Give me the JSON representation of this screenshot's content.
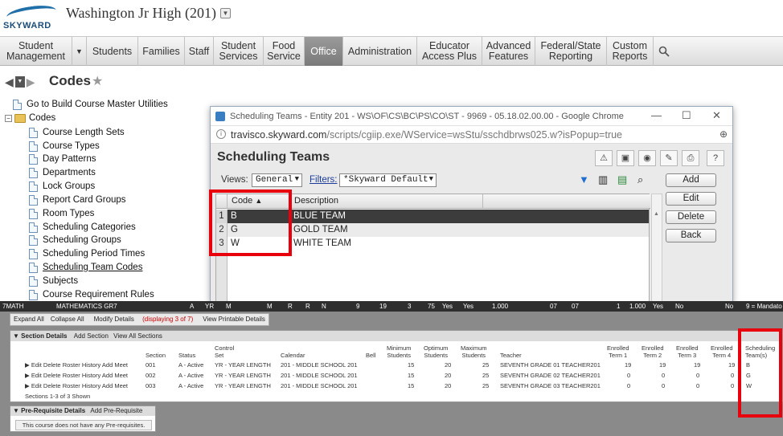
{
  "header": {
    "logo_text": "SKYWARD",
    "school": "Washington Jr High (201)"
  },
  "nav": [
    {
      "label": "Student\nManagement"
    },
    {
      "label": "Students"
    },
    {
      "label": "Families"
    },
    {
      "label": "Staff"
    },
    {
      "label": "Student\nServices"
    },
    {
      "label": "Food\nService"
    },
    {
      "label": "Office",
      "active": true
    },
    {
      "label": "Administration"
    },
    {
      "label": "Educator\nAccess Plus"
    },
    {
      "label": "Advanced\nFeatures"
    },
    {
      "label": "Federal/State\nReporting"
    },
    {
      "label": "Custom\nReports"
    }
  ],
  "page_title": "Codes",
  "tree": {
    "top": "Go to Build Course Master Utilities",
    "folder": "Codes",
    "items": [
      "Course Length Sets",
      "Course Types",
      "Day Patterns",
      "Departments",
      "Lock Groups",
      "Report Card Groups",
      "Room Types",
      "Scheduling Categories",
      "Scheduling Groups",
      "Scheduling Period Times",
      "Scheduling Team Codes",
      "Subjects",
      "Course Requirement Rules"
    ]
  },
  "popup": {
    "window_title": "Scheduling Teams - Entity 201 - WS\\OF\\CS\\BC\\PS\\CO\\ST - 9969 - 05.18.02.00.00 - Google Chrome",
    "url_host": "travisco.skyward.com",
    "url_path": "/scripts/cgiip.exe/WService=wsStu/sschdbrws025.w?isPopup=true",
    "title": "Scheduling Teams",
    "views_label": "Views:",
    "views_value": "General",
    "filters_label": "Filters:",
    "filters_value": "*Skyward Default",
    "columns": [
      "Code",
      "Description"
    ],
    "rows": [
      {
        "num": "1",
        "code": "B",
        "desc": "BLUE TEAM"
      },
      {
        "num": "2",
        "code": "G",
        "desc": "GOLD TEAM"
      },
      {
        "num": "3",
        "code": "W",
        "desc": "WHITE TEAM"
      }
    ],
    "buttons": [
      "Add",
      "Edit",
      "Delete",
      "Back"
    ]
  },
  "darkbar": [
    "7MATH",
    "MATHEMATICS GR7",
    "A",
    "YR",
    "M",
    "M",
    "R",
    "R",
    "N",
    "9",
    "19",
    "3",
    "75",
    "Yes",
    "Yes",
    "1.000",
    "07",
    "07",
    "1",
    "1.000",
    "Yes",
    "No",
    "No",
    "9 = Mandato"
  ],
  "lower": {
    "toolbar": [
      "Expand All",
      "Collapse All",
      "Modify Details"
    ],
    "displaying": "(displaying 3 of 7)",
    "printable": "View Printable Details",
    "section_header": "Section Details",
    "add_section": "Add Section",
    "view_all": "View All Sections",
    "columns": [
      "Section",
      "Status",
      "Control\nSet",
      "Calendar",
      "Bell",
      "Minimum\nStudents",
      "Optimum\nStudents",
      "Maximum\nStudents",
      "Teacher",
      "Enrolled\nTerm 1",
      "Enrolled\nTerm 2",
      "Enrolled\nTerm 3",
      "Enrolled\nTerm 4",
      "Scheduling\nTeam(s)"
    ],
    "row_actions": [
      "Edit",
      "Delete",
      "Roster",
      "History",
      "Add Meet"
    ],
    "rows": [
      {
        "section": "001",
        "status": "A - Active",
        "control": "YR - YEAR LENGTH",
        "calendar": "201 - MIDDLE SCHOOL 201",
        "min": "15",
        "opt": "20",
        "max": "25",
        "teacher": "SEVENTH GRADE 01 TEACHER201",
        "t1": "19",
        "t2": "19",
        "t3": "19",
        "t4": "19",
        "team": "B"
      },
      {
        "section": "002",
        "status": "A - Active",
        "control": "YR - YEAR LENGTH",
        "calendar": "201 - MIDDLE SCHOOL 201",
        "min": "15",
        "opt": "20",
        "max": "25",
        "teacher": "SEVENTH GRADE 02 TEACHER201",
        "t1": "0",
        "t2": "0",
        "t3": "0",
        "t4": "0",
        "team": "G"
      },
      {
        "section": "003",
        "status": "A - Active",
        "control": "YR - YEAR LENGTH",
        "calendar": "201 - MIDDLE SCHOOL 201",
        "min": "15",
        "opt": "20",
        "max": "25",
        "teacher": "SEVENTH GRADE 03 TEACHER201",
        "t1": "0",
        "t2": "0",
        "t3": "0",
        "t4": "0",
        "team": "W"
      }
    ],
    "shown": "Sections 1-3 of 3 Shown",
    "prereq_header": "Pre-Requisite Details",
    "add_prereq": "Add Pre-Requisite",
    "prereq_note": "This course does not have any Pre-requisites."
  }
}
